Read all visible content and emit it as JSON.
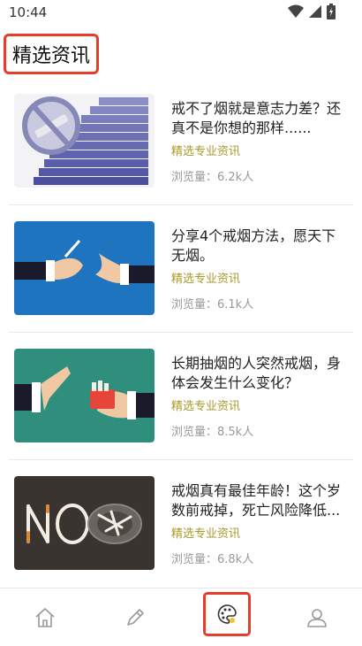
{
  "status": {
    "time": "10:44"
  },
  "header": {
    "title": "精选资讯"
  },
  "articles": [
    {
      "title": "戒不了烟就是意志力差？还真不是你想的那样......",
      "tag": "精选专业资讯",
      "views": "浏览量：6.2k人",
      "thumb": "stairs-quit-smoking-image"
    },
    {
      "title": "分享4个戒烟方法，愿天下无烟。",
      "tag": "精选专业资讯",
      "views": "浏览量：6.1k人",
      "thumb": "hands-refuse-cigarette-image"
    },
    {
      "title": "长期抽烟的人突然戒烟，身体会发生什么变化？",
      "tag": "精选专业资讯",
      "views": "浏览量：8.5k人",
      "thumb": "hand-stop-cigarettes-image"
    },
    {
      "title": "戒烟真有最佳年龄！这个岁数前戒掉，死亡风险降低...",
      "tag": "精选专业资讯",
      "views": "浏览量：6.8k人",
      "thumb": "no-cigarettes-image"
    }
  ],
  "tabbar": {
    "tabs": [
      {
        "name": "home",
        "icon": "home-icon"
      },
      {
        "name": "edit",
        "icon": "pencil-icon"
      },
      {
        "name": "news",
        "icon": "palette-icon",
        "active": true
      },
      {
        "name": "profile",
        "icon": "user-icon"
      }
    ]
  },
  "colors": {
    "accent": "#e53c2b",
    "tag": "#a89a2a"
  }
}
